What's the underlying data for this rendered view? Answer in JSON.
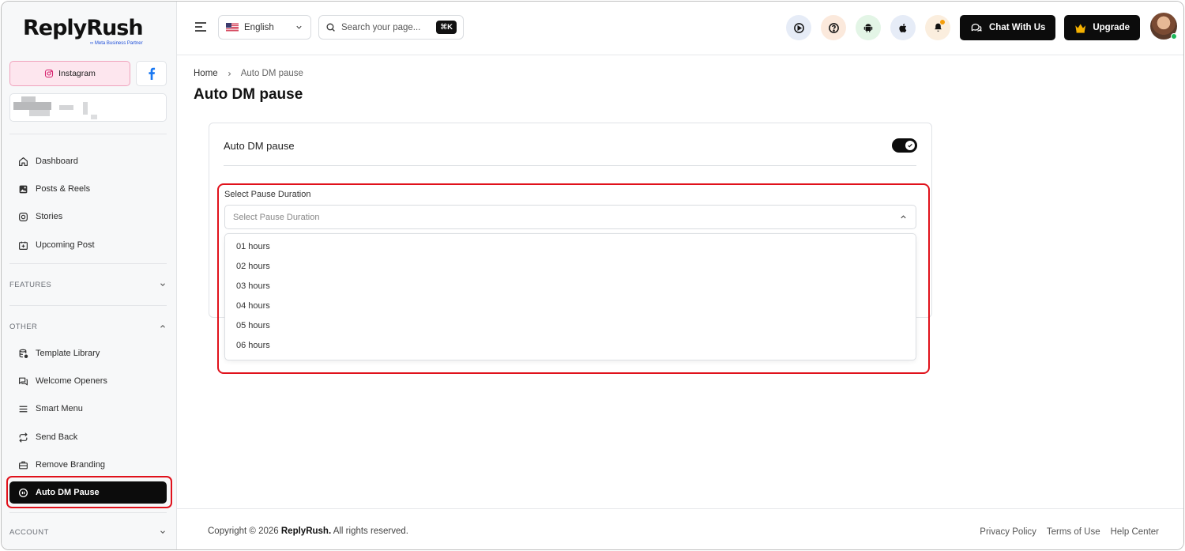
{
  "brand": {
    "name": "ReplyRush",
    "tagline": "Meta Business Partner"
  },
  "social": {
    "instagram": "Instagram"
  },
  "sidebar": {
    "main_items": [
      {
        "label": "Dashboard",
        "icon": "home-icon"
      },
      {
        "label": "Posts & Reels",
        "icon": "image-icon"
      },
      {
        "label": "Stories",
        "icon": "instagram-icon"
      },
      {
        "label": "Upcoming Post",
        "icon": "calendar-plus-icon"
      }
    ],
    "features_label": "FEATURES",
    "other_label": "OTHER",
    "other_items": [
      {
        "label": "Template Library",
        "icon": "database-icon"
      },
      {
        "label": "Welcome Openers",
        "icon": "chat-icon"
      },
      {
        "label": "Smart Menu",
        "icon": "menu-icon"
      },
      {
        "label": "Send Back",
        "icon": "repeat-icon"
      },
      {
        "label": "Remove Branding",
        "icon": "briefcase-icon"
      },
      {
        "label": "Auto DM Pause",
        "icon": "pause-circle-icon",
        "active": true
      }
    ],
    "account_label": "ACCOUNT"
  },
  "header": {
    "language": "English",
    "search_placeholder": "Search your page...",
    "search_shortcut": "⌘K",
    "chat_button": "Chat With Us",
    "upgrade_button": "Upgrade"
  },
  "breadcrumb": {
    "home": "Home",
    "current": "Auto DM pause"
  },
  "page": {
    "title": "Auto DM pause",
    "toggle_label": "Auto DM pause",
    "toggle_on": true,
    "field_label": "Select Pause Duration",
    "select_placeholder": "Select Pause Duration",
    "options": [
      "01 hours",
      "02 hours",
      "03 hours",
      "04 hours",
      "05 hours",
      "06 hours"
    ]
  },
  "footer": {
    "copyright_prefix": "Copyright © 2026",
    "copyright_brand": "ReplyRush.",
    "copyright_suffix": "All rights reserved.",
    "links": [
      "Privacy Policy",
      "Terms of Use",
      "Help Center"
    ]
  },
  "colors": {
    "accent_dark": "#0c0c0c",
    "highlight_red": "#e0111b",
    "instagram_pink": "#fde6ee",
    "facebook_blue": "#1877f2",
    "online_green": "#1fb85a"
  }
}
